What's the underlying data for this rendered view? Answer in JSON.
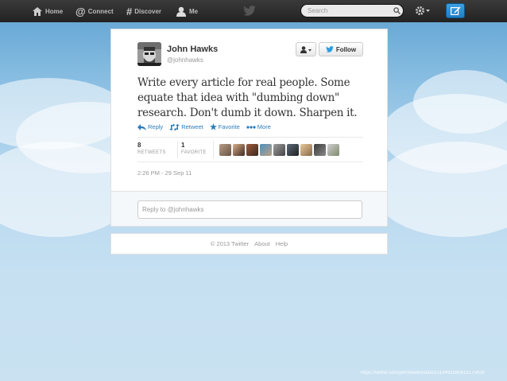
{
  "nav": {
    "home": "Home",
    "connect": "Connect",
    "discover": "Discover",
    "me": "Me",
    "search_placeholder": "Search"
  },
  "tweet": {
    "author_name": "John Hawks",
    "author_handle": "@johnhawks",
    "follow_label": "Follow",
    "text": "Write every article for real people. Some equate that idea with \"dumbing down\" research. Don't dumb it down. Sharpen it.",
    "actions": {
      "reply": "Reply",
      "retweet": "Retweet",
      "favorite": "Favorite",
      "more": "More"
    },
    "stats": {
      "retweets_count": "8",
      "retweets_label": "RETWEETS",
      "favorites_count": "1",
      "favorites_label": "FAVORITE"
    },
    "timestamp": "2:26 PM - 29 Sep 11"
  },
  "reply": {
    "value": "Reply to @johnhawks"
  },
  "footer": {
    "copyright": "© 2013 Twitter",
    "about": "About",
    "help": "Help"
  },
  "source_url": "https://twitter.com/johnhawks/status/119491580915175428",
  "colors": {
    "link": "#2b7bb9",
    "compose": "#1e7fc8"
  },
  "icons": [
    "home-icon",
    "connect-icon",
    "discover-icon",
    "me-icon",
    "twitter-bird-icon",
    "search-icon",
    "gear-icon",
    "compose-icon",
    "user-actions-icon",
    "reply-icon",
    "retweet-icon",
    "favorite-icon",
    "more-icon"
  ]
}
